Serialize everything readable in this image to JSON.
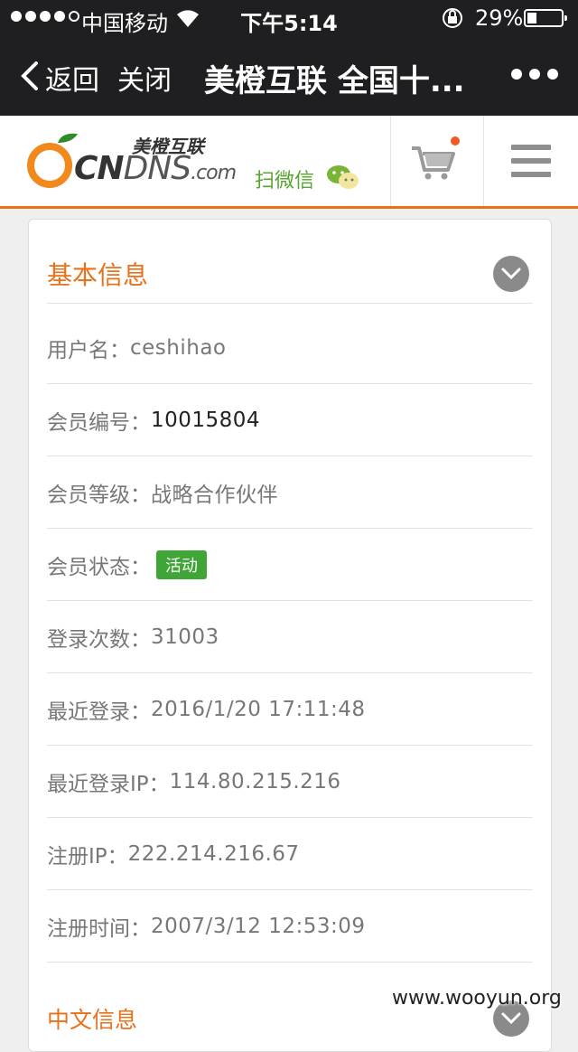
{
  "status_bar": {
    "carrier": "中国移动",
    "time": "下午5:14",
    "battery_percent": "29%",
    "battery_level": 0.29
  },
  "nav_bar": {
    "back_label": "返回",
    "close_label": "关闭",
    "title": "美橙互联 全国十..."
  },
  "site_header": {
    "logo_cn": "美橙互联",
    "logo_bold": "CN",
    "logo_light": "DNS",
    "logo_suffix": ".com",
    "scan_label": "扫微信"
  },
  "basic_info": {
    "title": "基本信息",
    "rows": [
      {
        "label": "用户名：",
        "value": "ceshihao"
      },
      {
        "label": "会员编号：",
        "value": "10015804"
      },
      {
        "label": "会员等级：",
        "value": "战略合作伙伴"
      },
      {
        "label": "会员状态：",
        "value": "活动"
      },
      {
        "label": "登录次数：",
        "value": "31003"
      },
      {
        "label": "最近登录：",
        "value": "2016/1/20 17:11:48"
      },
      {
        "label": "最近登录IP：",
        "value": "114.80.215.216"
      },
      {
        "label": "注册IP：",
        "value": "222.214.216.67"
      },
      {
        "label": "注册时间：",
        "value": "2007/3/12 12:53:09"
      }
    ]
  },
  "chinese_info": {
    "title": "中文信息"
  },
  "watermark": "www.wooyun.org",
  "colors": {
    "accent": "#e9711c",
    "badge": "#3fa536",
    "wechat": "#56a52e",
    "dark_bar": "#1f1f21"
  }
}
